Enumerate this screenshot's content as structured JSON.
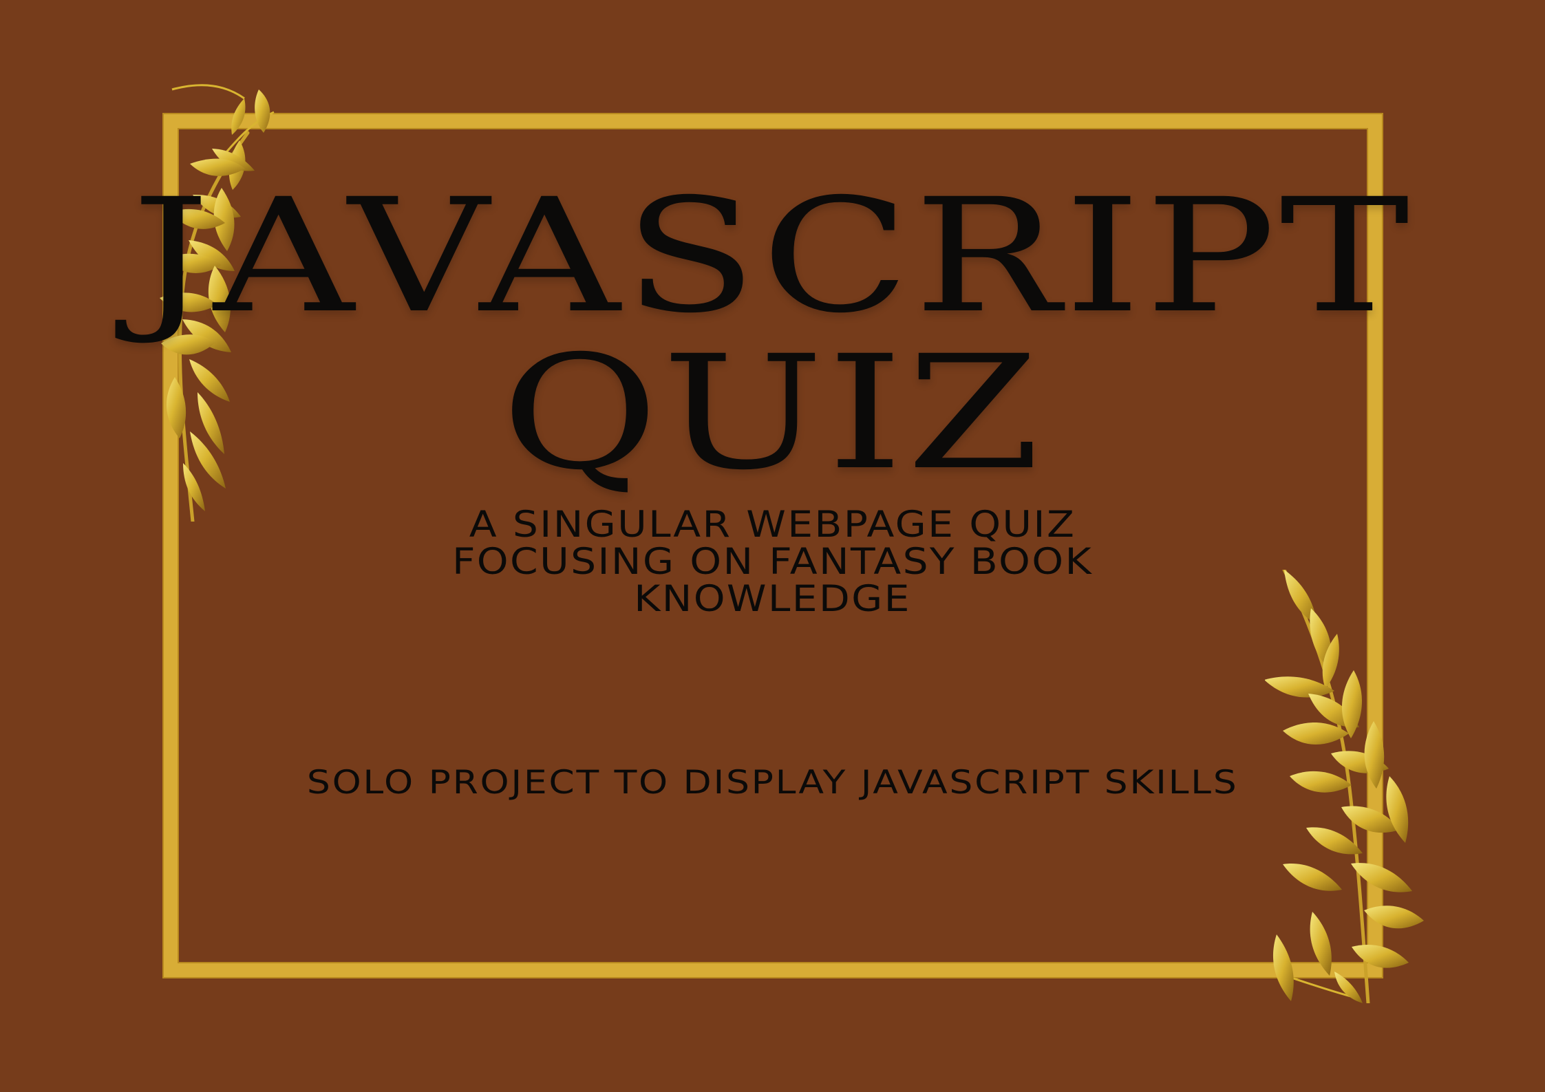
{
  "poster": {
    "title_line_1": "JAVASCRIPT",
    "title_line_2": "QUIZ",
    "subtitle_lines": [
      "A SINGULAR WEBPAGE QUIZ",
      "FOCUSING ON FANTASY BOOK",
      "KNOWLEDGE"
    ],
    "tagline": "SOLO PROJECT TO DISPLAY JAVASCRIPT SKILLS"
  },
  "decorations": {
    "top_left_icon": "gold-leaf-branch-icon",
    "bottom_right_icon": "gold-leaf-branch-icon",
    "frame_icon": "gold-frame"
  },
  "colors": {
    "background": "#763c1b",
    "gold": "#d8ad36",
    "gold_dark": "#b8891f",
    "text": "#0b0a09"
  }
}
